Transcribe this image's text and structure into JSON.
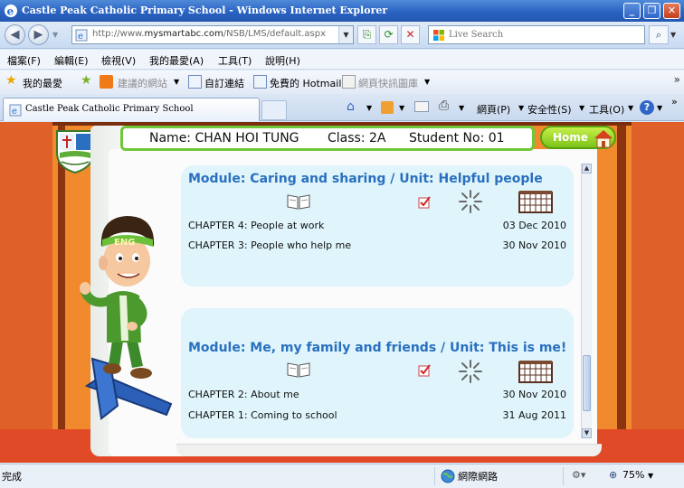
{
  "window": {
    "title": "Castle Peak Catholic Primary School - Windows Internet Explorer",
    "min_label": "_",
    "max_label": "❐",
    "close_label": "✕"
  },
  "address": {
    "url_prefix": "http://www.",
    "url_domain": "mysmartabc.com",
    "url_path": "/NSB/LMS/default.aspx",
    "search_placeholder": "Live Search"
  },
  "menu": [
    "檔案(F)",
    "編輯(E)",
    "檢視(V)",
    "我的最愛(A)",
    "工具(T)",
    "說明(H)"
  ],
  "favorites": {
    "label": "我的最愛",
    "items": [
      "建議的網站",
      "自訂連結",
      "免費的 Hotmail",
      "網頁快訊圖庫"
    ]
  },
  "tab": {
    "title": "Castle Peak Catholic Primary School"
  },
  "commands": {
    "page": "網頁(P)",
    "safety": "安全性(S)",
    "tools": "工具(O)"
  },
  "student": {
    "name": "Name: CHAN HOI TUNG",
    "class": "Class: 2A",
    "number": "Student No: 01"
  },
  "home_label": "Home",
  "modules": [
    {
      "title": "Module: Caring and sharing / Unit: Helpful people",
      "chapters": [
        {
          "name": "CHAPTER 4: People at work",
          "date": "03 Dec 2010"
        },
        {
          "name": "CHAPTER 3: People who help me",
          "date": "30 Nov 2010"
        }
      ]
    },
    {
      "title": "Module: Me, my family and friends / Unit: This is me!",
      "chapters": [
        {
          "name": "CHAPTER 2: About me",
          "date": "30 Nov 2010"
        },
        {
          "name": "CHAPTER 1: Coming to school",
          "date": "31 Aug 2011"
        }
      ]
    }
  ],
  "mascot_headband": "ENG",
  "status": {
    "left": "完成",
    "zone": "網際網路",
    "zoom": "75%"
  },
  "colors": {
    "module_title": "#2a6fc0",
    "panel_bg": "#dff5fb",
    "frame_orange": "#f08a2c",
    "home_green": "#7cc319"
  },
  "icons": [
    "ie-logo",
    "back-icon",
    "forward-icon",
    "refresh-icon",
    "stop-icon",
    "search-icon",
    "star-icon",
    "home-icon",
    "book-icon",
    "check-icon",
    "sparkle-icon",
    "calendar-icon",
    "globe-icon"
  ]
}
